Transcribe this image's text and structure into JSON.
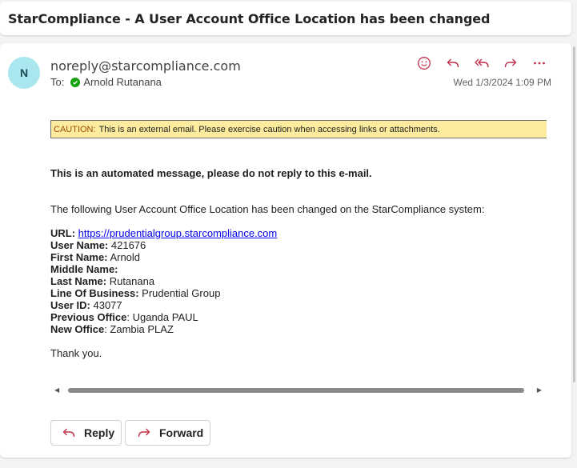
{
  "subject": "StarCompliance - A User Account Office Location has been changed",
  "header": {
    "avatar_initial": "N",
    "sender": "noreply@starcompliance.com",
    "to_label": "To:",
    "recipient": "Arnold Rutanana",
    "date": "Wed 1/3/2024 1:09 PM",
    "action_icons": [
      "emoji-icon",
      "reply-icon",
      "reply-all-icon",
      "forward-icon",
      "more-icon"
    ]
  },
  "caution": {
    "label": "CAUTION:",
    "text": "This is an external email. Please exercise caution when accessing links or attachments."
  },
  "body": {
    "automated": "This is an automated message, please do not reply to this e-mail.",
    "intro": "The following User Account Office Location has been changed on the StarCompliance system:",
    "fields": {
      "url_label": "URL:",
      "url": "https://prudentialgroup.starcompliance.com",
      "user_name_label": "User Name:",
      "user_name": "421676",
      "first_name_label": "First Name:",
      "first_name": "Arnold",
      "middle_name_label": "Middle Name:",
      "middle_name": "",
      "last_name_label": "Last Name:",
      "last_name": "Rutanana",
      "lob_label": "Line Of Business:",
      "lob": "Prudential Group",
      "user_id_label": "User ID:",
      "user_id": "43077",
      "prev_office_label": "Previous Office",
      "prev_office": ": Uganda PAUL",
      "new_office_label": "New Office",
      "new_office": ": Zambia PLAZ"
    },
    "thanks": "Thank you."
  },
  "buttons": {
    "reply": "Reply",
    "forward": "Forward"
  },
  "colors": {
    "accent": "#c4314b",
    "caution_bg": "#fdec9e",
    "avatar_bg": "#a9e6ee",
    "presence": "#13a10e"
  }
}
